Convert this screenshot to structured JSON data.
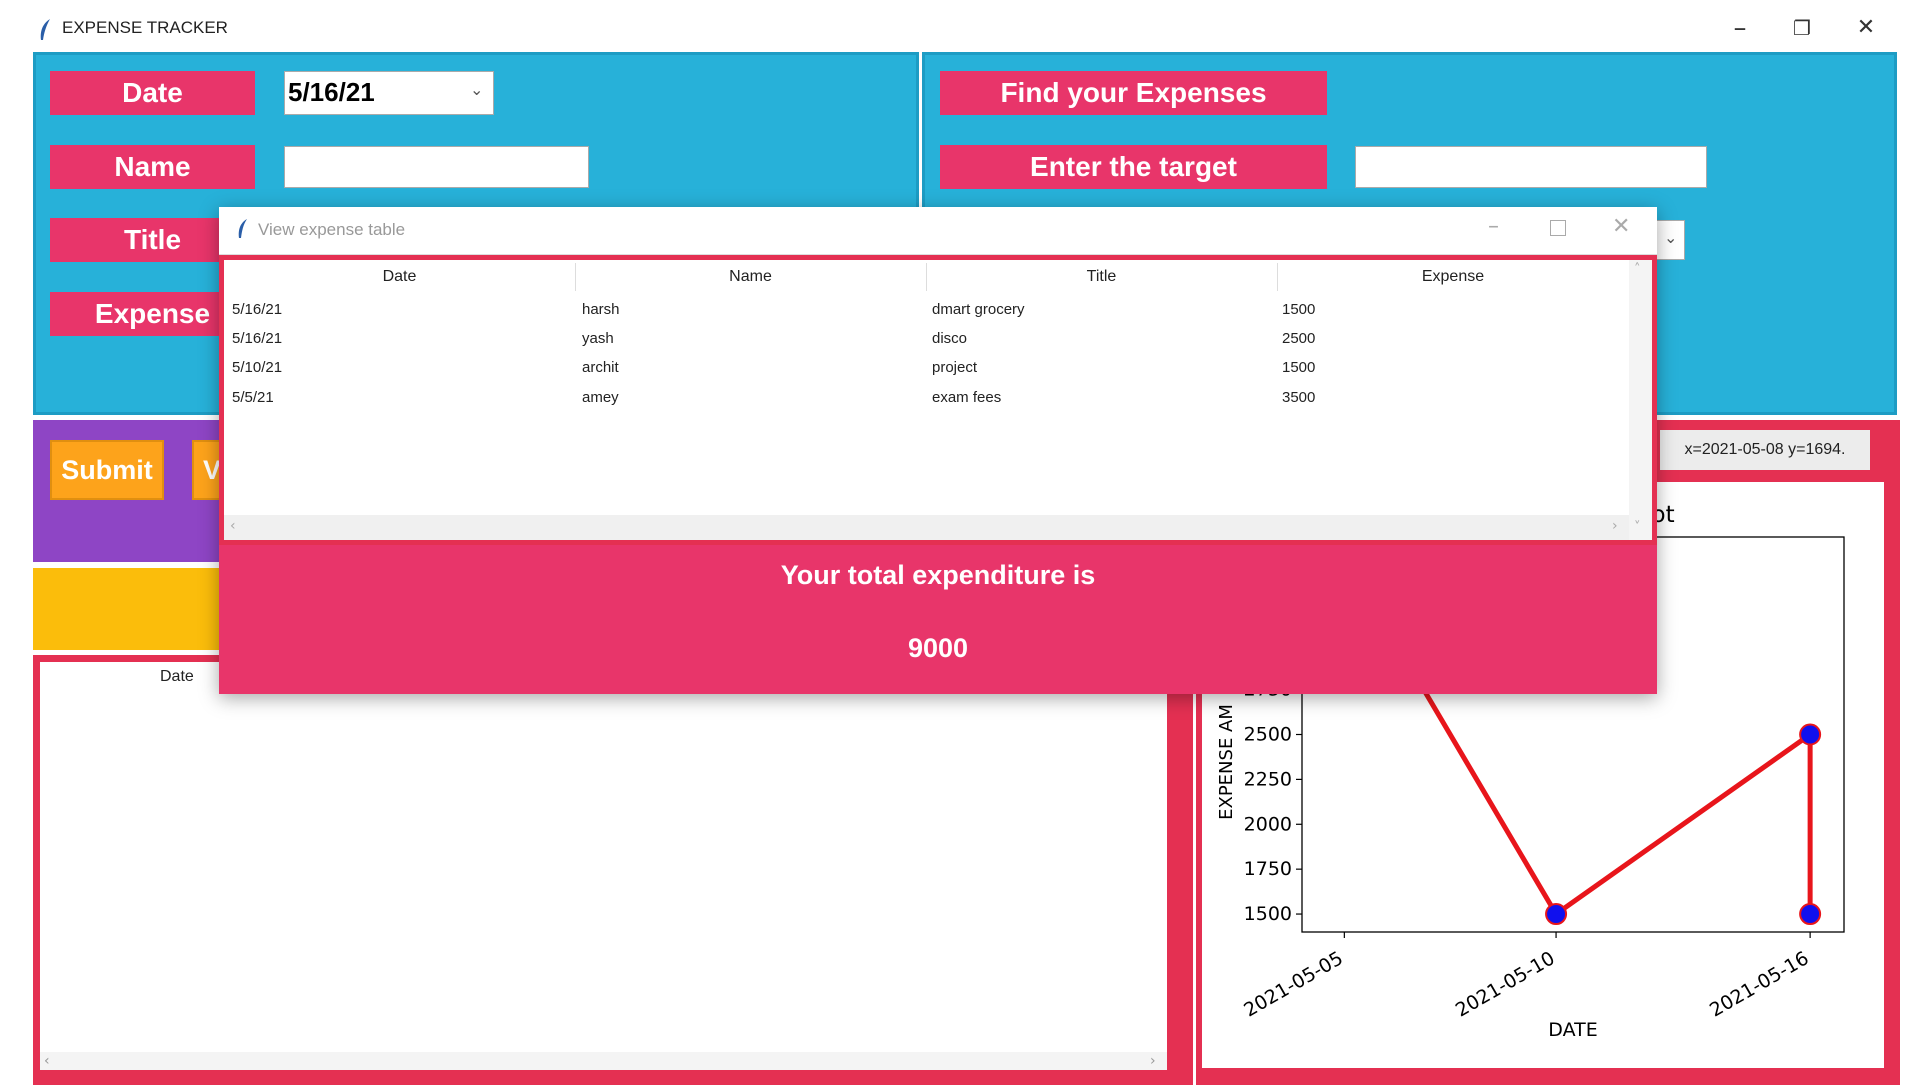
{
  "window": {
    "title": "EXPENSE TRACKER",
    "controls": {
      "minimize": "–",
      "maximize": "❐",
      "close": "✕"
    }
  },
  "form": {
    "date_label": "Date",
    "date_value": "5/16/21",
    "name_label": "Name",
    "name_value": "",
    "title_label": "Title",
    "expense_label": "Expense"
  },
  "right_form": {
    "find_label": "Find your Expenses",
    "target_label": "Enter the target",
    "target_value": ""
  },
  "buttons": {
    "submit": "Submit",
    "view_partial": "V"
  },
  "main_table": {
    "header_date": "Date"
  },
  "plot_toolbar": {
    "coordinate_readout": "x=2021-05-08 y=1694."
  },
  "popup": {
    "title": "View expense table",
    "columns": [
      "Date",
      "Name",
      "Title",
      "Expense"
    ],
    "rows": [
      {
        "date": "5/16/21",
        "name": "harsh",
        "title": "dmart grocery",
        "expense": "1500"
      },
      {
        "date": "5/16/21",
        "name": "yash",
        "title": "disco",
        "expense": "2500"
      },
      {
        "date": "5/10/21",
        "name": "archit",
        "title": "project",
        "expense": "1500"
      },
      {
        "date": "5/5/21",
        "name": "amey",
        "title": "exam fees",
        "expense": "3500"
      }
    ],
    "total_label": "Your total expenditure is",
    "total_value": "9000"
  },
  "colors": {
    "panel_blue": "#27b1d9",
    "pink": "#e8356a",
    "red_border": "#e43052",
    "purple": "#8e45c5",
    "yellow": "#fbbd0b",
    "orange_button": "#fda31b",
    "line_color": "#e8151b",
    "marker_color": "#1010ee"
  },
  "chart_data": {
    "type": "line",
    "title_visible_fragment": "g Plot",
    "ylabel_visible_fragment": "EXPENSE AM",
    "xlabel": "DATE",
    "x": [
      "2021-05-05",
      "2021-05-10",
      "2021-05-16",
      "2021-05-16"
    ],
    "y": [
      3500,
      1500,
      2500,
      1500
    ],
    "xticks": [
      "2021-05-05",
      "2021-05-10",
      "2021-05-16"
    ],
    "yticks": [
      1500,
      1750,
      2000,
      2250,
      2500,
      2750
    ],
    "ylim": [
      1400,
      3600
    ],
    "grid": false,
    "marker": "circle"
  }
}
